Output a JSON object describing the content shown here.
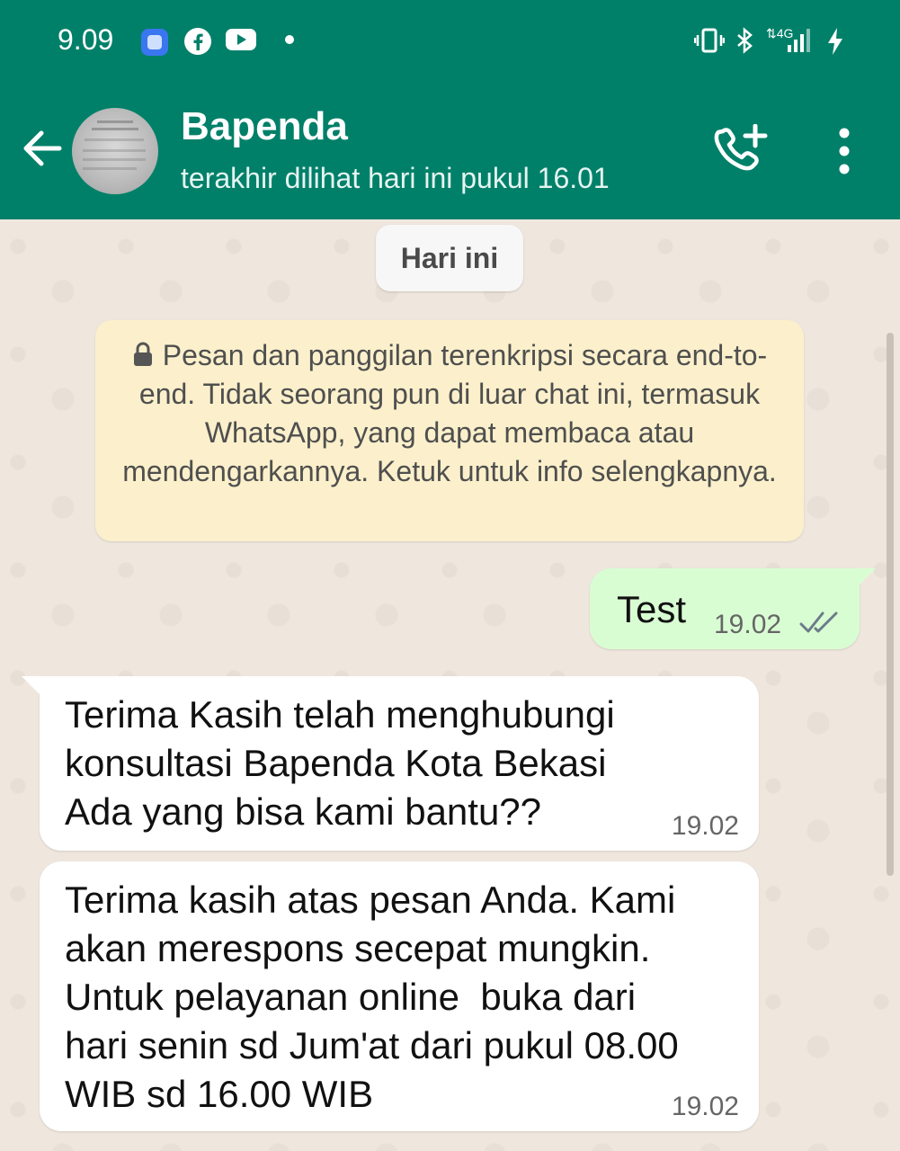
{
  "status_bar": {
    "time": "9.09",
    "network": "4G"
  },
  "header": {
    "contact_name": "Bapenda",
    "last_seen": "terakhir dilihat hari ini pukul 16.01"
  },
  "chat": {
    "date_chip": "Hari ini",
    "encryption_notice": "Pesan dan panggilan terenkripsi secara end-to-end. Tidak seorang pun di luar chat ini, termasuk WhatsApp, yang dapat membaca atau mendengarkannya. Ketuk untuk info selengkapnya.",
    "messages": [
      {
        "direction": "out",
        "text": "Test",
        "time": "19.02",
        "status": "read"
      },
      {
        "direction": "in",
        "text": "Terima Kasih telah menghubungi\nkonsultasi Bapenda Kota Bekasi\nAda yang bisa kami bantu??",
        "time": "19.02"
      },
      {
        "direction": "in",
        "text": "Terima kasih atas pesan Anda. Kami\nakan merespons secepat mungkin.\nUntuk pelayanan online  buka dari\nhari senin sd Jum'at dari pukul 08.00\nWIB sd 16.00 WIB",
        "time": "19.02"
      }
    ]
  },
  "colors": {
    "header": "#008069",
    "outgoing_bubble": "#d9fdd3",
    "incoming_bubble": "#ffffff",
    "encryption_banner": "#fbf0cb",
    "chat_background": "#efe7de"
  },
  "icons": [
    "signal-app-icon",
    "facebook-icon",
    "youtube-icon",
    "vibrate-icon",
    "bluetooth-icon",
    "signal-bars-icon",
    "charging-icon",
    "back-arrow-icon",
    "add-call-icon",
    "more-vert-icon",
    "lock-icon",
    "double-check-icon"
  ]
}
